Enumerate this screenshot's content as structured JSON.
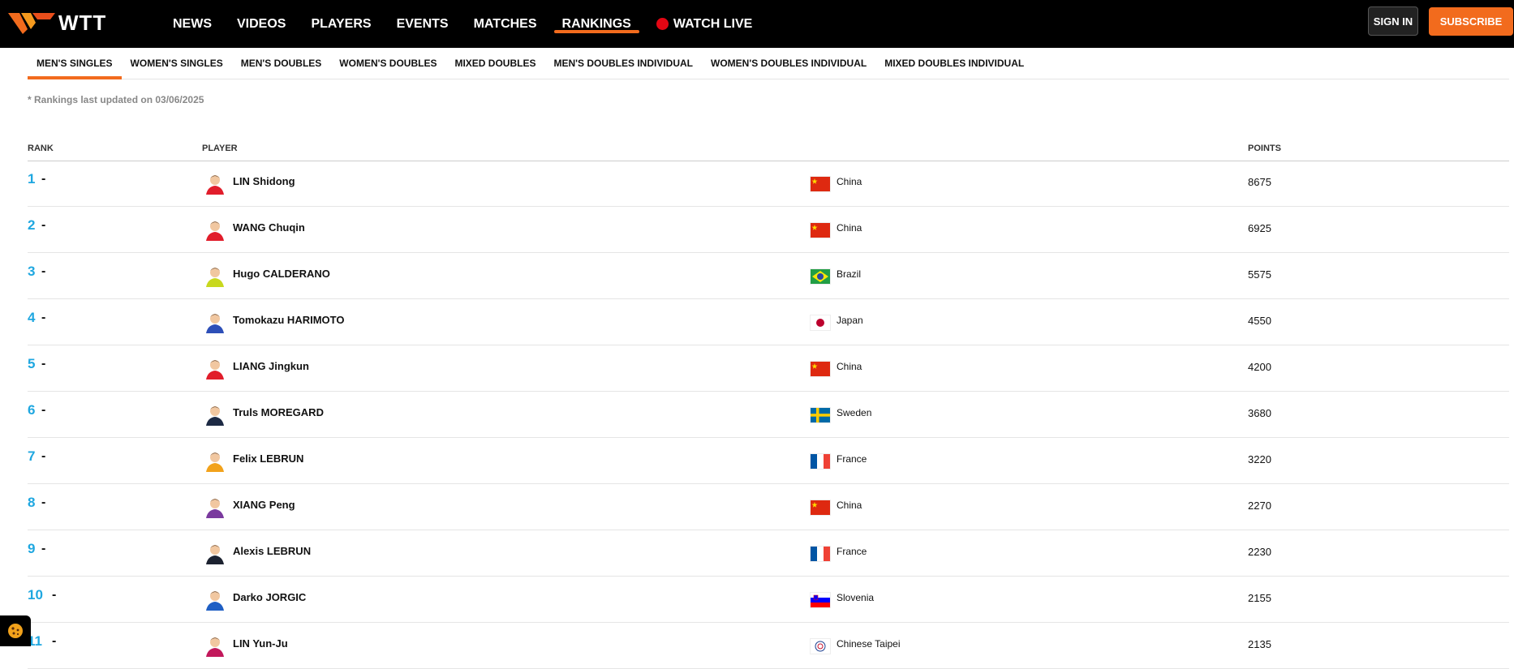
{
  "brand": {
    "name": "WTT",
    "accent": "#f26b1d"
  },
  "nav": [
    {
      "label": "NEWS"
    },
    {
      "label": "VIDEOS"
    },
    {
      "label": "PLAYERS"
    },
    {
      "label": "EVENTS"
    },
    {
      "label": "MATCHES"
    },
    {
      "label": "RANKINGS",
      "active": true
    },
    {
      "label": "WATCH LIVE"
    }
  ],
  "auth": {
    "signin_label": "SIGN IN",
    "subscribe_label": "SUBSCRIBE"
  },
  "subnav": [
    {
      "label": "MEN'S SINGLES",
      "active": true
    },
    {
      "label": "WOMEN'S SINGLES"
    },
    {
      "label": "MEN'S DOUBLES"
    },
    {
      "label": "WOMEN'S DOUBLES"
    },
    {
      "label": "MIXED DOUBLES"
    },
    {
      "label": "MEN'S DOUBLES INDIVIDUAL"
    },
    {
      "label": "WOMEN'S DOUBLES INDIVIDUAL"
    },
    {
      "label": "MIXED DOUBLES INDIVIDUAL"
    }
  ],
  "updated_note": "* Rankings last updated on 03/06/2025",
  "table": {
    "headers": {
      "rank": "RANK",
      "player": "PLAYER",
      "points": "POINTS"
    },
    "rows": [
      {
        "rank": "1",
        "change": "-",
        "name": "LIN Shidong",
        "country": "China",
        "flag": "china-flag-icon",
        "points": "8675",
        "kit": "#e11d2b"
      },
      {
        "rank": "2",
        "change": "-",
        "name": "WANG Chuqin",
        "country": "China",
        "flag": "china-flag-icon",
        "points": "6925",
        "kit": "#e11d2b"
      },
      {
        "rank": "3",
        "change": "-",
        "name": "Hugo CALDERANO",
        "country": "Brazil",
        "flag": "brazil-flag-icon",
        "points": "5575",
        "kit": "#c8d81e"
      },
      {
        "rank": "4",
        "change": "-",
        "name": "Tomokazu HARIMOTO",
        "country": "Japan",
        "flag": "japan-flag-icon",
        "points": "4550",
        "kit": "#2d4fb8"
      },
      {
        "rank": "5",
        "change": "-",
        "name": "LIANG Jingkun",
        "country": "China",
        "flag": "china-flag-icon",
        "points": "4200",
        "kit": "#e11d2b"
      },
      {
        "rank": "6",
        "change": "-",
        "name": "Truls MOREGARD",
        "country": "Sweden",
        "flag": "sweden-flag-icon",
        "points": "3680",
        "kit": "#1d2a44"
      },
      {
        "rank": "7",
        "change": "-",
        "name": "Felix LEBRUN",
        "country": "France",
        "flag": "france-flag-icon",
        "points": "3220",
        "kit": "#f2a21b"
      },
      {
        "rank": "8",
        "change": "-",
        "name": "XIANG Peng",
        "country": "China",
        "flag": "china-flag-icon",
        "points": "2270",
        "kit": "#7a3a9e"
      },
      {
        "rank": "9",
        "change": "-",
        "name": "Alexis LEBRUN",
        "country": "France",
        "flag": "france-flag-icon",
        "points": "2230",
        "kit": "#1c2230"
      },
      {
        "rank": "10",
        "change": "-",
        "name": "Darko JORGIC",
        "country": "Slovenia",
        "flag": "slovenia-flag-icon",
        "points": "2155",
        "kit": "#1f5fc4"
      },
      {
        "rank": "11",
        "change": "-",
        "name": "LIN Yun-Ju",
        "country": "Chinese Taipei",
        "flag": "chinese-taipei-flag-icon",
        "points": "2135",
        "kit": "#c2185b"
      }
    ]
  }
}
